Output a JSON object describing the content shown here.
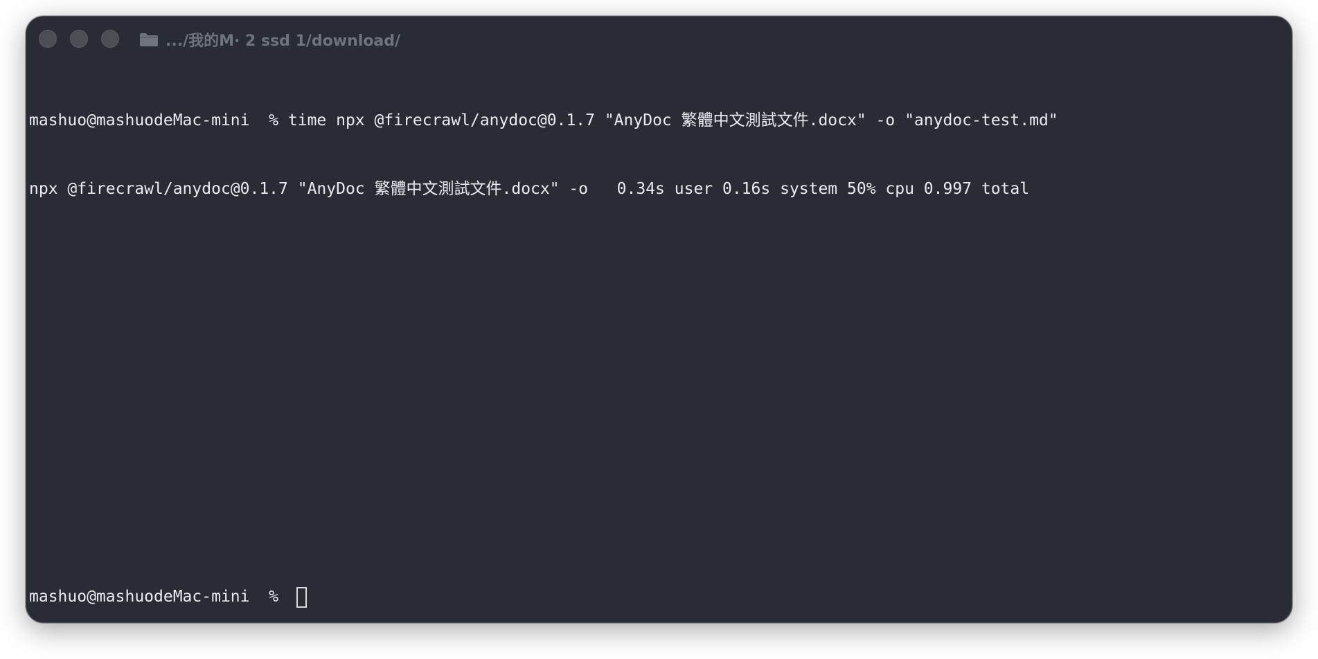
{
  "window": {
    "title": ".../我的M· 2 ssd 1/download/",
    "folder_icon": "folder-icon",
    "traffic_lights": [
      "close-button",
      "minimize-button",
      "zoom-button"
    ],
    "colors": {
      "background": "#292c34",
      "text": "#e9ebef",
      "title": "#6f737b"
    }
  },
  "terminal": {
    "lines": [
      "mashuo@mashuodeMac-mini  % time npx @firecrawl/anydoc@0.1.7 \"AnyDoc 繁體中文測試文件.docx\" -o \"anydoc-test.md\"",
      "npx @firecrawl/anydoc@0.1.7 \"AnyDoc 繁體中文測試文件.docx\" -o   0.34s user 0.16s system 50% cpu 0.997 total"
    ],
    "prompt": "mashuo@mashuodeMac-mini  % "
  }
}
